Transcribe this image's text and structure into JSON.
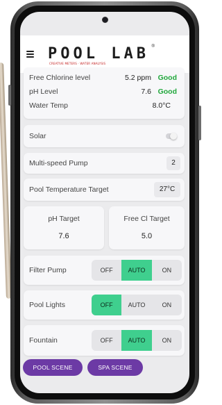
{
  "app": {
    "logo_text": "POOL LAB",
    "logo_tagline": "CREATIVE METERS · WATER ANALYSIS",
    "logo_mark": "®"
  },
  "water_status": {
    "rows": [
      {
        "label": "Free Chlorine level",
        "value": "5.2 ppm",
        "status": "Good"
      },
      {
        "label": "pH Level",
        "value": "7.6",
        "status": "Good"
      },
      {
        "label": "Water Temp",
        "value": "8.0°C",
        "status": ""
      }
    ],
    "status_color": "#22a83d"
  },
  "solar": {
    "label": "Solar",
    "enabled": false
  },
  "pump": {
    "label": "Multi-speed Pump",
    "value": "2"
  },
  "pool_temp": {
    "label": "Pool Temperature Target",
    "value": "27°C"
  },
  "ph_target": {
    "label": "pH Target",
    "value": "7.6"
  },
  "cl_target": {
    "label": "Free Cl Target",
    "value": "5.0"
  },
  "controls": [
    {
      "label": "Filter Pump",
      "options": [
        "OFF",
        "AUTO",
        "ON"
      ],
      "selected": "AUTO"
    },
    {
      "label": "Pool Lights",
      "options": [
        "OFF",
        "AUTO",
        "ON"
      ],
      "selected": "OFF"
    },
    {
      "label": "Fountain",
      "options": [
        "OFF",
        "AUTO",
        "ON"
      ],
      "selected": "AUTO"
    }
  ],
  "active_color": "#3fcf8e",
  "scenes": {
    "pool": "POOL SCENE",
    "spa": "SPA SCENE",
    "color": "#6c3aa5"
  }
}
